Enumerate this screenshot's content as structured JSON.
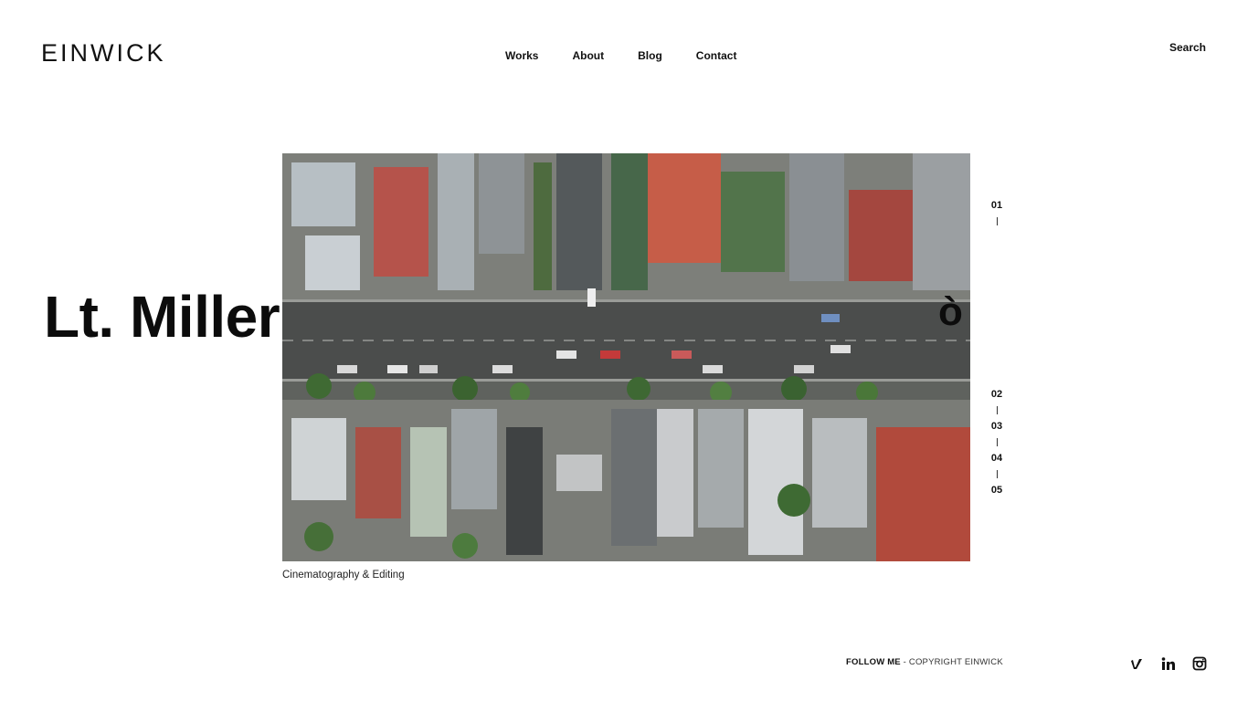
{
  "header": {
    "logo": "EINWICK",
    "nav": [
      {
        "label": "Works"
      },
      {
        "label": "About"
      },
      {
        "label": "Blog"
      },
      {
        "label": "Contact"
      }
    ],
    "search_label": "Search"
  },
  "hero": {
    "title": "Lt. Miller",
    "caption": "Cinematography & Editing",
    "image_alt": "aerial view of a street with houses and cars"
  },
  "pager": {
    "items": [
      "01",
      "02",
      "03",
      "04",
      "05"
    ],
    "current_big": "ò"
  },
  "footer": {
    "follow": "FOLLOW ME",
    "sep": " - ",
    "copyright": "COPYRIGHT EINWICK",
    "social_icons": [
      "vimeo-icon",
      "linkedin-icon",
      "instagram-icon"
    ]
  }
}
